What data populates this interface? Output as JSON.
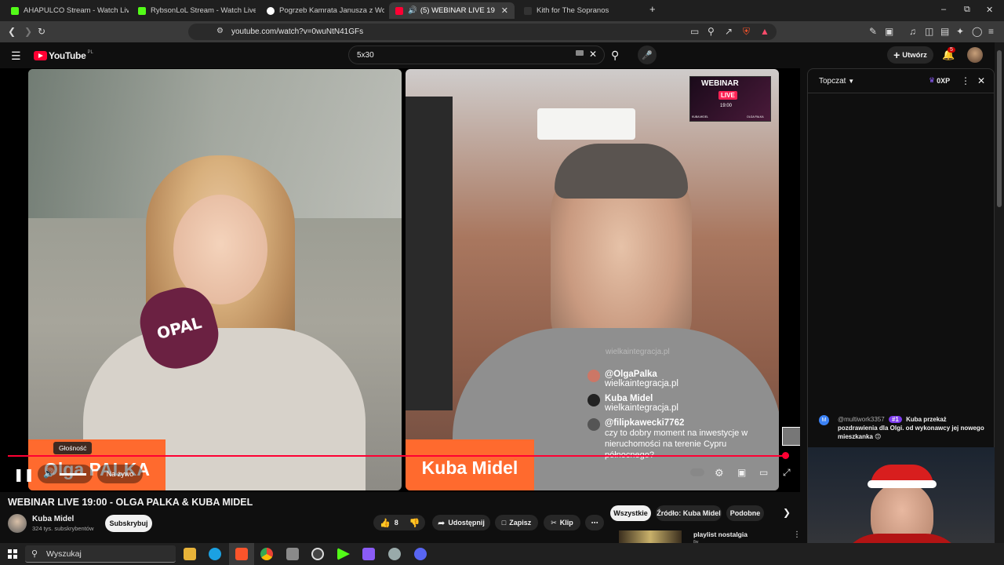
{
  "tabs": [
    {
      "title": "AHAPULCO Stream - Watch Live on K",
      "color": "#53fc18"
    },
    {
      "title": "RybsonLoL Stream - Watch Live on K",
      "color": "#53fc18"
    },
    {
      "title": "Pogrzeb Kamrata Janusza z Wojciech",
      "color": "#ffffff"
    },
    {
      "title": "(5) WEBINAR LIVE 19:00 - OLG",
      "color": "#ff0033"
    },
    {
      "title": "Kith for The Sopranos",
      "color": "#222222"
    }
  ],
  "browser": {
    "url": "youtube.com/watch?v=0wuNtN41GFs",
    "new_tab": "+",
    "win_min": "–",
    "win_max": "⧉",
    "win_close": "✕"
  },
  "header": {
    "logo": "YouTube",
    "country": "PL",
    "search_value": "5x30",
    "create_label": "Utwórz",
    "notif_count": "5"
  },
  "player": {
    "left_name": "Olga PALKA",
    "mic_brand": "OPAL",
    "right_name": "Kuba Midel",
    "webinar_badge": "WEBINAR",
    "webinar_live": "LIVE",
    "webinar_time": "19:00",
    "badge_person_left": "KUBA MIDEL",
    "badge_person_right": "OLGA PALKA",
    "volume_tooltip": "Głośność",
    "live_label": "Na żywo",
    "overlay_comments": [
      {
        "user": "@OlgaPalka",
        "text": "wielkaintegracja.pl"
      },
      {
        "user": "Kuba Midel",
        "text": "wielkaintegracja.pl"
      },
      {
        "user": "@filipkawecki7762",
        "text": "czy to dobry moment na inwestycje w nieruchomości na terenie Cypru północnego?"
      }
    ],
    "overlay_prev": "wielkaintegracja.pl"
  },
  "video": {
    "title": "WEBINAR LIVE 19:00 - OLGA PALKA & KUBA MIDEL",
    "channel": "Kuba Midel",
    "subs": "324 tys. subskrybentów",
    "subscribe": "Subskrybuj",
    "likes": "8",
    "share": "Udostępnij",
    "save": "Zapisz",
    "clip": "Klip",
    "more": "⋯"
  },
  "chips": [
    "Wszystkie",
    "Źródło: Kuba Midel",
    "Podobne"
  ],
  "related": {
    "title": "playlist nostalgia",
    "sub": "8w"
  },
  "chat": {
    "mode": "Topczat",
    "points": "0XP",
    "message": {
      "avatar": "M",
      "user": "@multiwork3357",
      "badge": "#1",
      "text": "Kuba przekaż pozdrawienia dla Olgi. od wykonawcy jej nowego mieszkanka",
      "emoji": "🙃"
    }
  },
  "taskbar": {
    "search_placeholder": "Wyszukaj",
    "santa_hat_note": ""
  }
}
